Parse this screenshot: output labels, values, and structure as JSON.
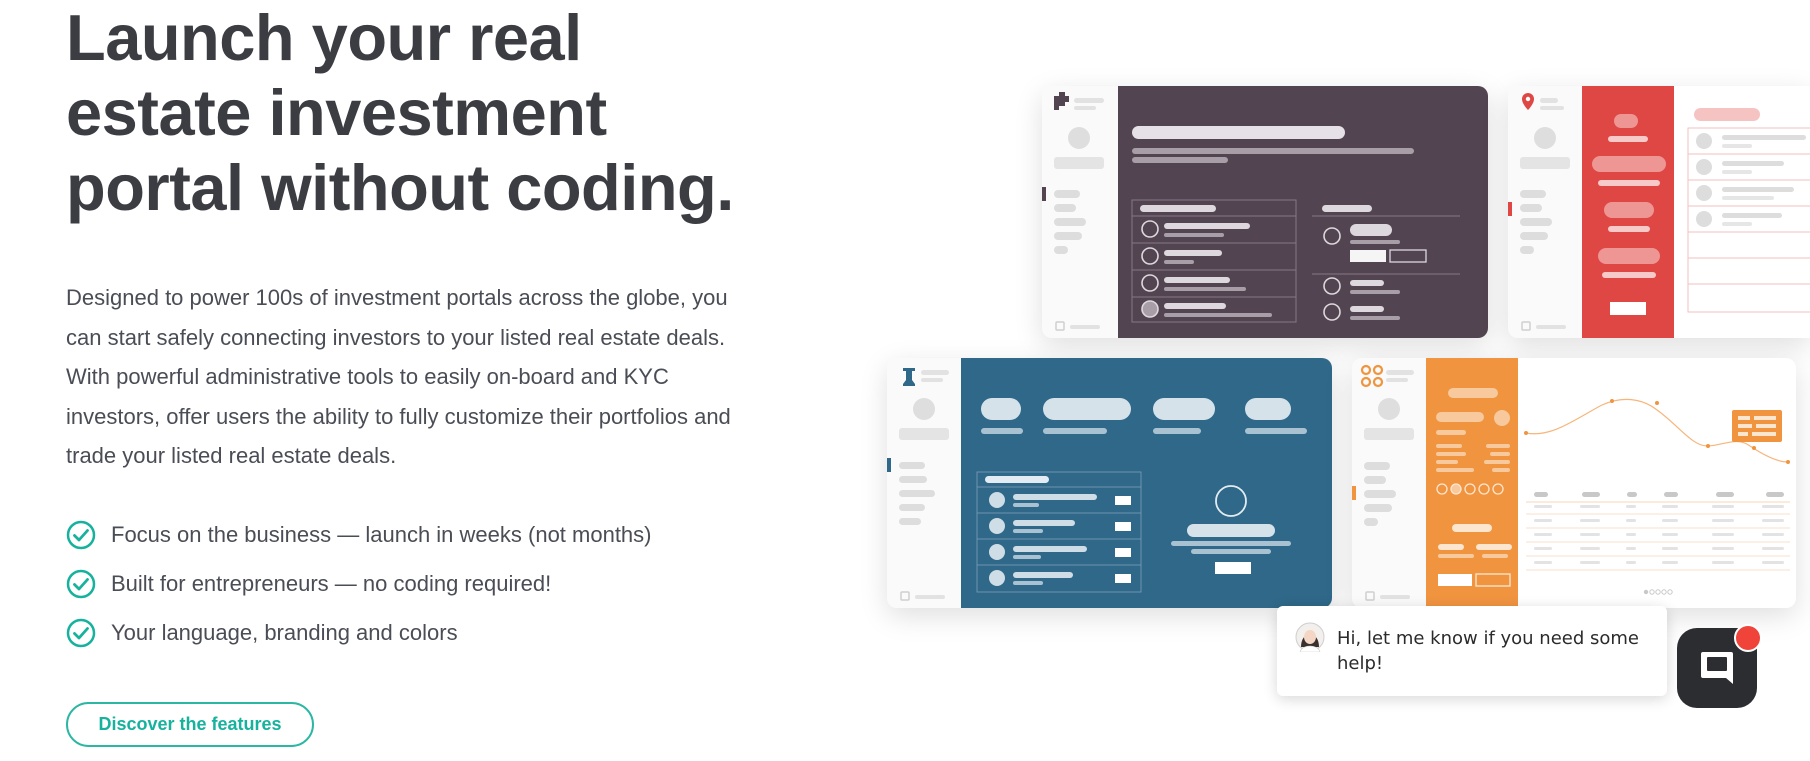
{
  "hero": {
    "title": "Launch your real estate investment portal without coding.",
    "description": "Designed to power 100s of investment portals across the globe, you can start safely connecting investors to your listed real estate deals. With powerful administrative tools to easily on-board and KYC investors, offer users the ability to fully customize their portfolios and trade your listed real estate deals."
  },
  "features": [
    {
      "label": "Focus on the business — launch in weeks (not months)"
    },
    {
      "label": "Built for entrepreneurs — no coding required!"
    },
    {
      "label": "Your language, branding and colors"
    }
  ],
  "cta": {
    "label": "Discover the features"
  },
  "chat": {
    "message": "Hi, let me know if you need some help!",
    "launcher_icon": "chat-bubble-icon",
    "notification_color": "#f0443a"
  },
  "colors": {
    "accent": "#16b29d",
    "heading": "#3b3d42",
    "card_dark": "#524450",
    "card_red": "#de4744",
    "card_blue": "#2f6889",
    "card_orange": "#f09440"
  }
}
